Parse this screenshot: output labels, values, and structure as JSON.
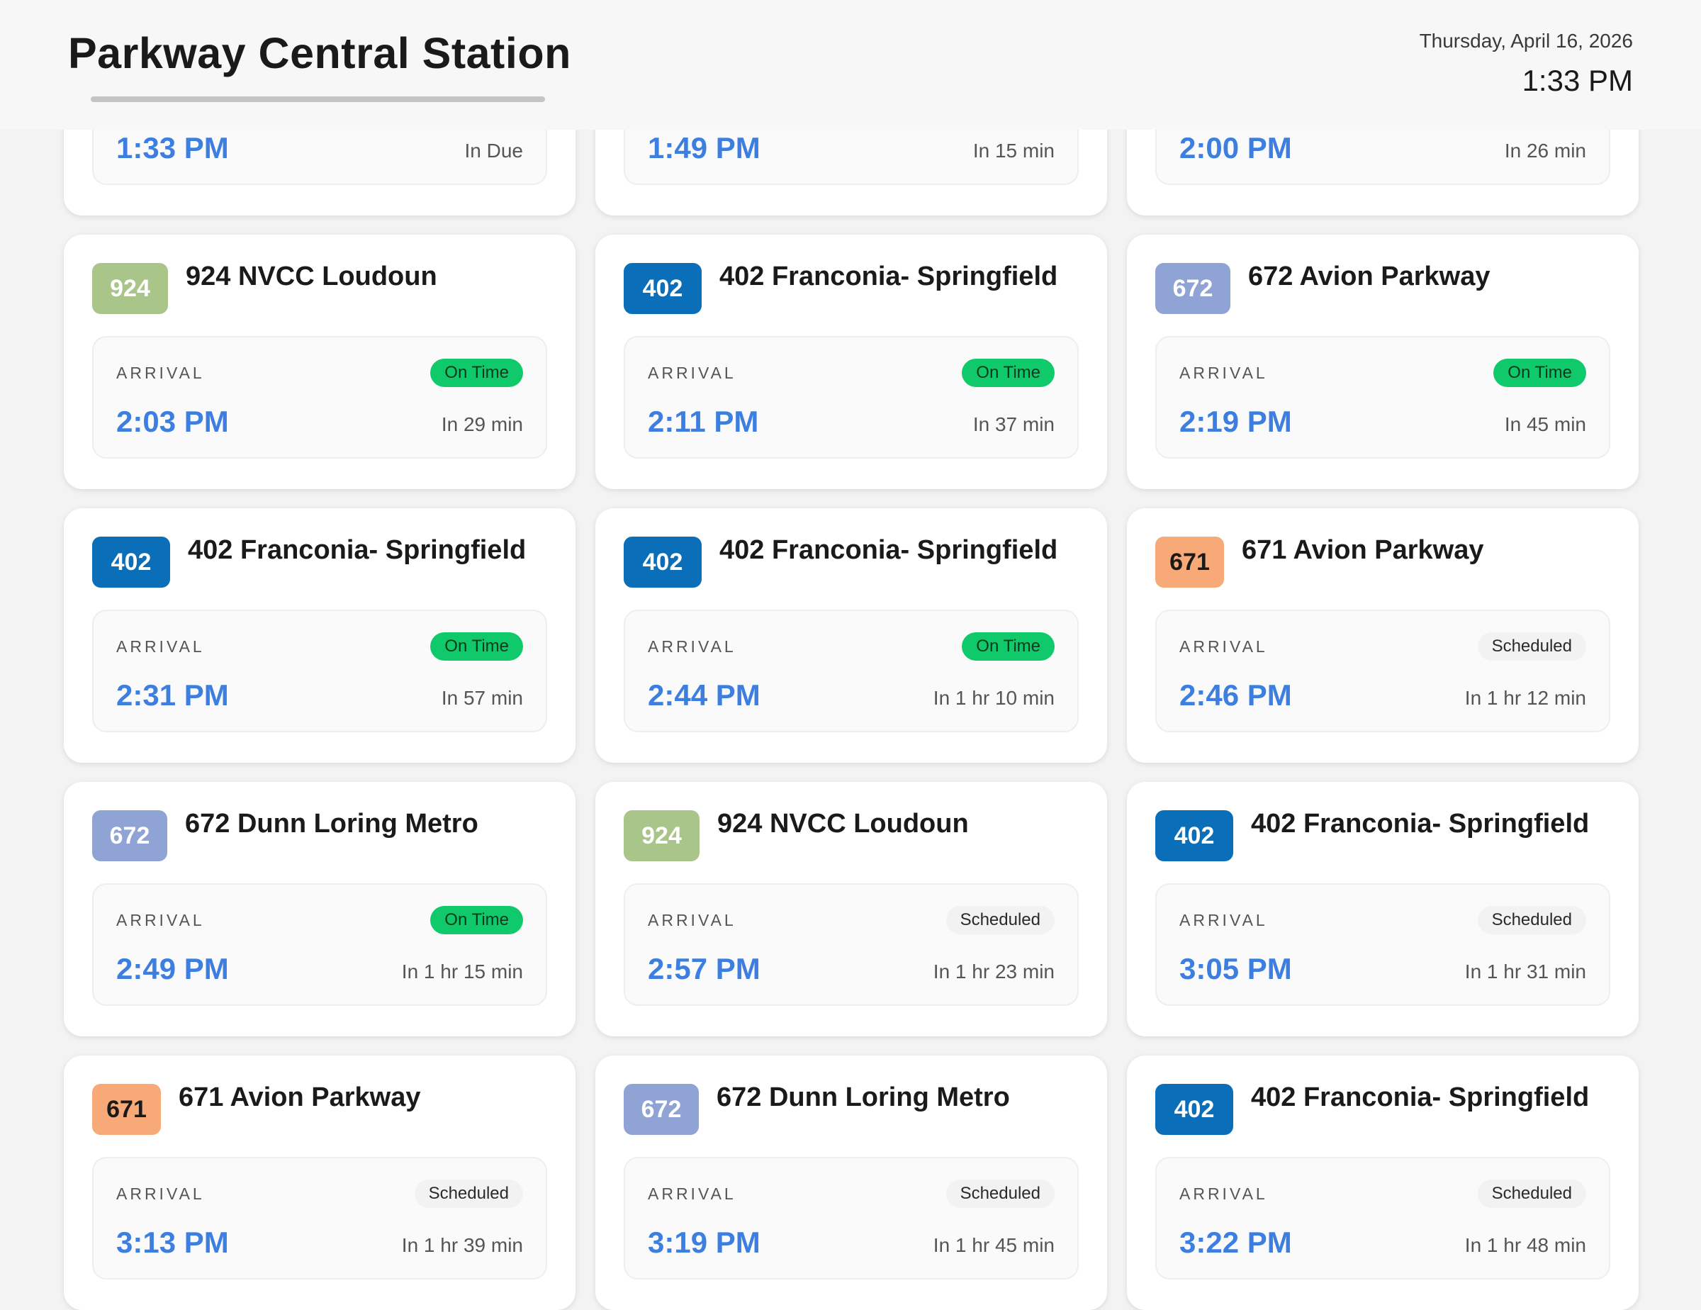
{
  "header": {
    "station_name": "Parkway Central Station",
    "date": "Thursday, April 16, 2026",
    "time": "1:33 PM"
  },
  "colors": {
    "924": "#a9c58a",
    "402": "#0a6eb8",
    "672": "#8fa4d4",
    "671": "#f7aa78",
    "on_time": "#10c96b",
    "arrival_time": "#3d7fe0"
  },
  "arrival_label": "ARRIVAL",
  "departures": [
    {
      "route": "",
      "name": "",
      "status": "",
      "status_type": "",
      "time": "1:33 PM",
      "eta": "In Due"
    },
    {
      "route": "",
      "name": "",
      "status": "",
      "status_type": "",
      "time": "1:49 PM",
      "eta": "In 15 min"
    },
    {
      "route": "",
      "name": "",
      "status": "",
      "status_type": "",
      "time": "2:00 PM",
      "eta": "In 26 min"
    },
    {
      "route": "924",
      "name": "924 NVCC Loudoun",
      "status": "On Time",
      "status_type": "ontime",
      "time": "2:03 PM",
      "eta": "In 29 min"
    },
    {
      "route": "402",
      "name": "402 Franconia- Springfield",
      "status": "On Time",
      "status_type": "ontime",
      "time": "2:11 PM",
      "eta": "In 37 min"
    },
    {
      "route": "672",
      "name": "672 Avion Parkway",
      "status": "On Time",
      "status_type": "ontime",
      "time": "2:19 PM",
      "eta": "In 45 min"
    },
    {
      "route": "402",
      "name": "402 Franconia- Springfield",
      "status": "On Time",
      "status_type": "ontime",
      "time": "2:31 PM",
      "eta": "In 57 min"
    },
    {
      "route": "402",
      "name": "402 Franconia- Springfield",
      "status": "On Time",
      "status_type": "ontime",
      "time": "2:44 PM",
      "eta": "In 1 hr 10 min"
    },
    {
      "route": "671",
      "name": "671 Avion Parkway",
      "status": "Scheduled",
      "status_type": "scheduled",
      "time": "2:46 PM",
      "eta": "In 1 hr 12 min"
    },
    {
      "route": "672",
      "name": "672 Dunn Loring Metro",
      "status": "On Time",
      "status_type": "ontime",
      "time": "2:49 PM",
      "eta": "In 1 hr 15 min"
    },
    {
      "route": "924",
      "name": "924 NVCC Loudoun",
      "status": "Scheduled",
      "status_type": "scheduled",
      "time": "2:57 PM",
      "eta": "In 1 hr 23 min"
    },
    {
      "route": "402",
      "name": "402 Franconia- Springfield",
      "status": "Scheduled",
      "status_type": "scheduled",
      "time": "3:05 PM",
      "eta": "In 1 hr 31 min"
    },
    {
      "route": "671",
      "name": "671 Avion Parkway",
      "status": "Scheduled",
      "status_type": "scheduled",
      "time": "3:13 PM",
      "eta": "In 1 hr 39 min"
    },
    {
      "route": "672",
      "name": "672 Dunn Loring Metro",
      "status": "Scheduled",
      "status_type": "scheduled",
      "time": "3:19 PM",
      "eta": "In 1 hr 45 min"
    },
    {
      "route": "402",
      "name": "402 Franconia- Springfield",
      "status": "Scheduled",
      "status_type": "scheduled",
      "time": "3:22 PM",
      "eta": "In 1 hr 48 min"
    }
  ]
}
